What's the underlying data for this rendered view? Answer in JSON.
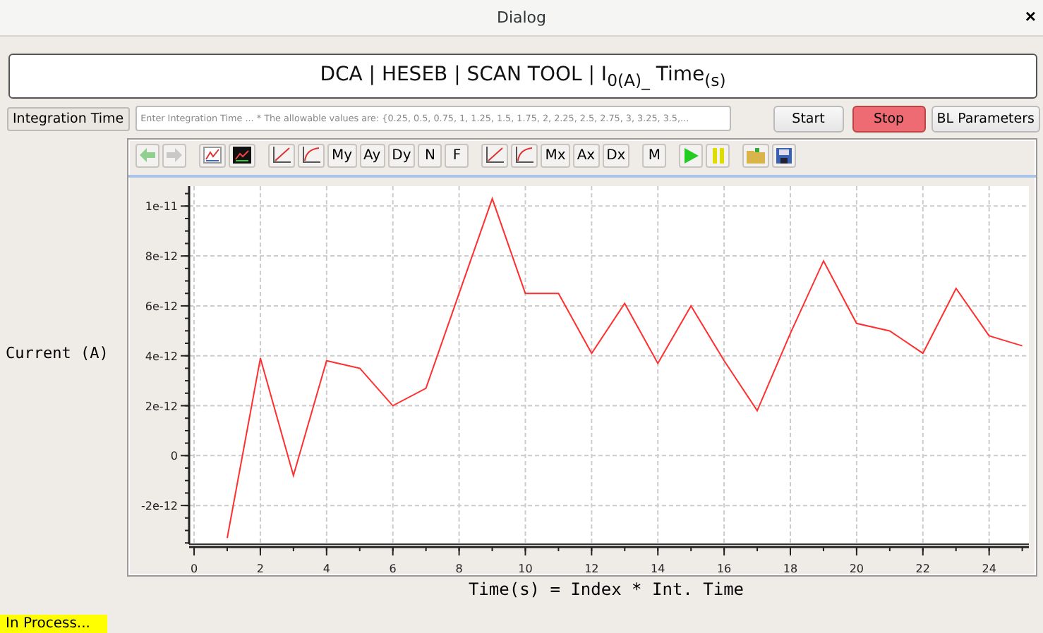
{
  "window": {
    "title": "Dialog",
    "close": "×"
  },
  "header": {
    "title": "DCA | HESEB | SCAN TOOL | I$_{0(A)_}$ Time$_{(s)}$"
  },
  "controls": {
    "label": "Integration Time",
    "input": {
      "placeholder": "Enter Integration Time ... * The allowable values are: {0.25, 0.5, 0.75, 1, 1.25, 1.5, 1.75, 2, 2.25, 2.5, 2.75, 3, 3.25, 3.5,..."
    },
    "buttons": [
      {
        "label": "Start",
        "kind": "normal"
      },
      {
        "label": "Stop",
        "kind": "danger"
      },
      {
        "label": "BL Parameters",
        "kind": "normal"
      }
    ]
  },
  "toolbar": {
    "y_buttons": [
      "My",
      "Ay",
      "Dy",
      "N",
      "F"
    ],
    "x_buttons": [
      "Mx",
      "Ax",
      "Dx"
    ],
    "mode_button": "M"
  },
  "plot": {
    "ylabel": "Current (A)",
    "xlabel": "Time(s) = Index * Int. Time",
    "chart_data": {
      "type": "line",
      "x": [
        1,
        2,
        3,
        4,
        5,
        6,
        7,
        8,
        9,
        10,
        11,
        12,
        13,
        14,
        15,
        16,
        17,
        18,
        19,
        20,
        21,
        22,
        23,
        24,
        25
      ],
      "series": [
        {
          "color": "#ff3030",
          "values": [
            -3.3e-12,
            3.9e-12,
            -8e-13,
            3.8e-12,
            3.5e-12,
            2e-12,
            2.7e-12,
            6.5e-12,
            1.03e-11,
            6.5e-12,
            6.5e-12,
            4.1e-12,
            6.1e-12,
            3.7e-12,
            6e-12,
            3.8e-12,
            1.8e-12,
            4.9e-12,
            7.8e-12,
            5.3e-12,
            5e-12,
            4.1e-12,
            6.7e-12,
            4.8e-12,
            4.4e-12
          ]
        }
      ],
      "grid": true,
      "xlim": [
        -0.15,
        25.2
      ],
      "ylim": [
        -3.55e-12,
        1.08e-11
      ],
      "xticks": [
        0,
        2,
        4,
        6,
        8,
        10,
        12,
        14,
        16,
        18,
        20,
        22,
        24
      ],
      "yticks": [
        {
          "value": -2e-12,
          "label": "-2e-12"
        },
        {
          "value": 0,
          "label": "0"
        },
        {
          "value": 2e-12,
          "label": "2e-12"
        },
        {
          "value": 4e-12,
          "label": "4e-12"
        },
        {
          "value": 6e-12,
          "label": "6e-12"
        },
        {
          "value": 8e-12,
          "label": "8e-12"
        },
        {
          "value": 1e-11,
          "label": "1e-11"
        }
      ]
    }
  },
  "status": {
    "text": "In Process..."
  }
}
